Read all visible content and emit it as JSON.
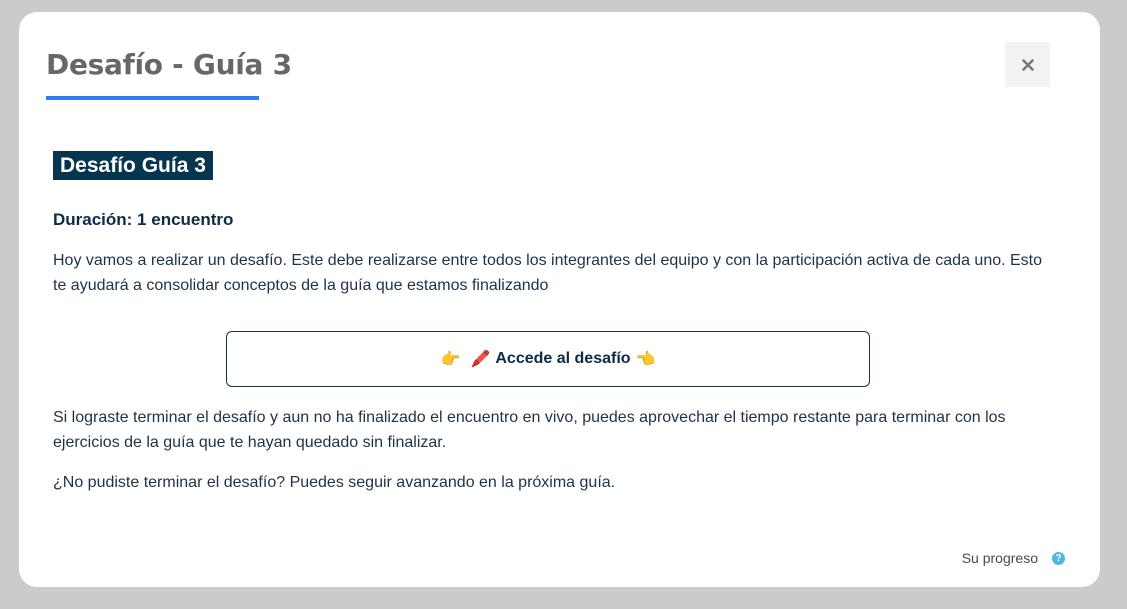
{
  "modal": {
    "title": "Desafío - Guía 3",
    "close_label": "×"
  },
  "content": {
    "heading": "Desafío Guía 3",
    "duration": "Duración: 1 encuentro",
    "paragraph_1": "Hoy vamos a realizar un desafío. Este debe realizarse entre todos los integrantes del equipo y con la participación activa de cada uno. Esto te ayudará a consolidar conceptos de la guía que estamos finalizando",
    "cta": {
      "emoji_left": "👉",
      "emoji_pencil": "🖍️",
      "label": "Accede al desafío",
      "emoji_right": "👈"
    },
    "paragraph_2": "Si lograste terminar el desafío y aun no ha finalizado el encuentro en vivo, puedes aprovechar el tiempo restante para terminar con los ejercicios de la guía que te hayan quedado sin finalizar.",
    "paragraph_3": "¿No pudiste terminar el desafío? Puedes seguir avanzando en la próxima guía."
  },
  "footer": {
    "progress_label": "Su progreso",
    "help_icon": "question-circle-icon",
    "help_glyph": "?"
  },
  "colors": {
    "accent": "#2e7cf6",
    "heading_bg": "#06354f",
    "help": "#4fb6e0"
  }
}
